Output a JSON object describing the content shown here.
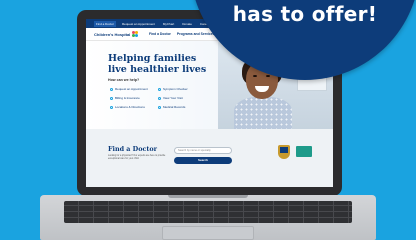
{
  "badge": {
    "text": "has to offer!"
  },
  "site": {
    "topbar": [
      "Find a Doctor",
      "Request an Appointment",
      "MyChart",
      "Donate",
      "Careers"
    ],
    "logo_name": "Children's Hospital",
    "nav": [
      "Find a Doctor",
      "Programs and Services",
      "Patients"
    ],
    "hero": {
      "title": "Helping families live healthier lives",
      "subtitle": "How can we help?",
      "links": [
        "Request an Appointment",
        "Symptom Checker",
        "Billing & Insurance",
        "View Your Visit",
        "Locations & Directions",
        "Medical Records"
      ]
    },
    "find": {
      "title": "Find a Doctor",
      "description": "Looking for a physician? Our experts are here to provide exceptional care for your child.",
      "search_placeholder": "Search by name or specialty",
      "search_button": "Search"
    }
  },
  "colors": {
    "background": "#1aa3e0",
    "brand_navy": "#0d3c7a"
  },
  "icons": [
    "children-logo-icon",
    "link-bullet-icon",
    "award-badge-icon",
    "accreditation-icon"
  ]
}
